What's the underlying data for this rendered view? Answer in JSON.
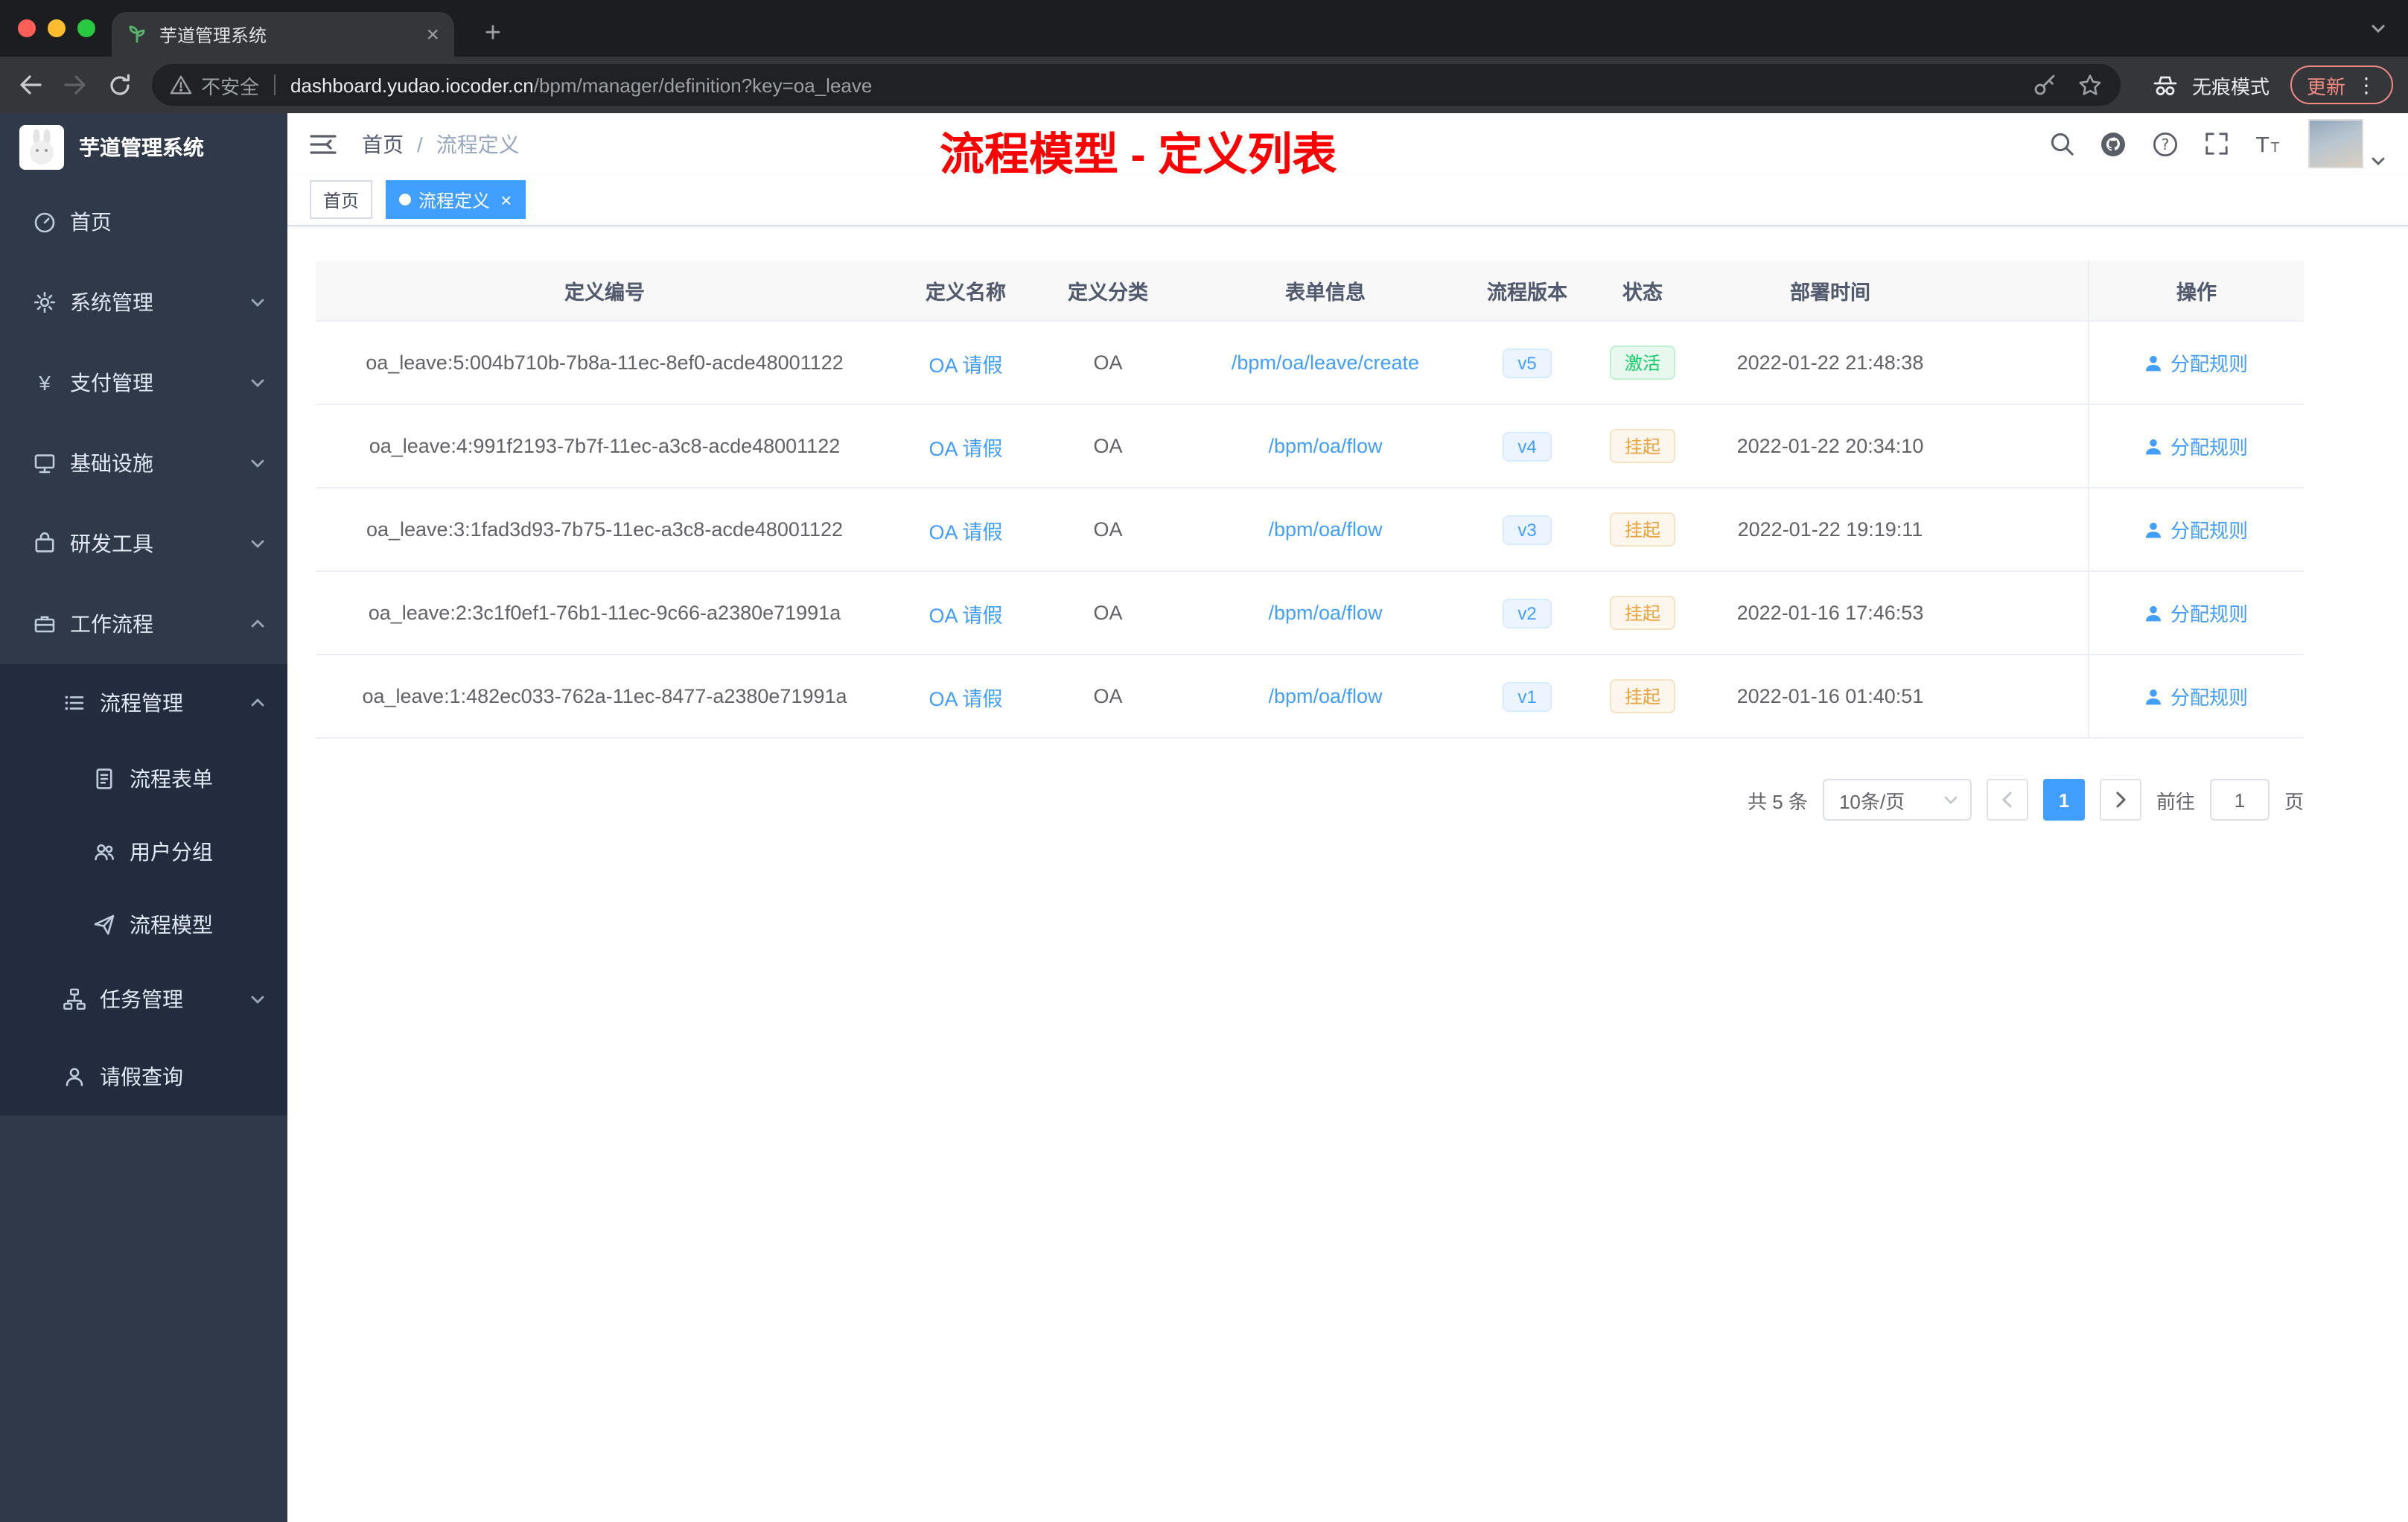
{
  "browser": {
    "tab_title": "芋道管理系统",
    "security_label": "不安全",
    "url_host": "dashboard.yudao.iocoder.cn",
    "url_path": "/bpm/manager/definition?key=oa_leave",
    "incognito_label": "无痕模式",
    "update_label": "更新"
  },
  "sidebar": {
    "logo_title": "芋道管理系统",
    "items": [
      {
        "label": "首页",
        "icon": "dashboard-icon"
      },
      {
        "label": "系统管理",
        "icon": "gear-icon"
      },
      {
        "label": "支付管理",
        "icon": "yen-icon"
      },
      {
        "label": "基础设施",
        "icon": "monitor-icon"
      },
      {
        "label": "研发工具",
        "icon": "toolbox-icon"
      },
      {
        "label": "工作流程",
        "icon": "briefcase-icon",
        "expanded": true,
        "children": [
          {
            "label": "流程管理",
            "icon": "list-icon",
            "expanded": true,
            "children": [
              {
                "label": "流程表单",
                "icon": "document-icon"
              },
              {
                "label": "用户分组",
                "icon": "users-icon"
              },
              {
                "label": "流程模型",
                "icon": "paper-plane-icon"
              }
            ]
          },
          {
            "label": "任务管理",
            "icon": "tree-icon"
          },
          {
            "label": "请假查询",
            "icon": "user-icon"
          }
        ]
      }
    ]
  },
  "header": {
    "breadcrumb": [
      "首页",
      "流程定义"
    ],
    "breadcrumb_separator": "/",
    "annotation": "流程模型 - 定义列表"
  },
  "tags": {
    "items": [
      {
        "label": "首页",
        "active": false
      },
      {
        "label": "流程定义",
        "active": true
      }
    ]
  },
  "table": {
    "columns": [
      "定义编号",
      "定义名称",
      "定义分类",
      "表单信息",
      "流程版本",
      "状态",
      "部署时间",
      "操作"
    ],
    "rows": [
      {
        "id": "oa_leave:5:004b710b-7b8a-11ec-8ef0-acde48001122",
        "name": "OA 请假",
        "category": "OA",
        "form": "/bpm/oa/leave/create",
        "version": "v5",
        "status": "激活",
        "status_type": "success",
        "deployed": "2022-01-22 21:48:38",
        "action": "分配规则"
      },
      {
        "id": "oa_leave:4:991f2193-7b7f-11ec-a3c8-acde48001122",
        "name": "OA 请假",
        "category": "OA",
        "form": "/bpm/oa/flow",
        "version": "v4",
        "status": "挂起",
        "status_type": "warning",
        "deployed": "2022-01-22 20:34:10",
        "action": "分配规则"
      },
      {
        "id": "oa_leave:3:1fad3d93-7b75-11ec-a3c8-acde48001122",
        "name": "OA 请假",
        "category": "OA",
        "form": "/bpm/oa/flow",
        "version": "v3",
        "status": "挂起",
        "status_type": "warning",
        "deployed": "2022-01-22 19:19:11",
        "action": "分配规则"
      },
      {
        "id": "oa_leave:2:3c1f0ef1-76b1-11ec-9c66-a2380e71991a",
        "name": "OA 请假",
        "category": "OA",
        "form": "/bpm/oa/flow",
        "version": "v2",
        "status": "挂起",
        "status_type": "warning",
        "deployed": "2022-01-16 17:46:53",
        "action": "分配规则"
      },
      {
        "id": "oa_leave:1:482ec033-762a-11ec-8477-a2380e71991a",
        "name": "OA 请假",
        "category": "OA",
        "form": "/bpm/oa/flow",
        "version": "v1",
        "status": "挂起",
        "status_type": "warning",
        "deployed": "2022-01-16 01:40:51",
        "action": "分配规则"
      }
    ]
  },
  "pagination": {
    "total": "共 5 条",
    "page_size": "10条/页",
    "page": "1",
    "goto_label": "前往",
    "goto_value": "1",
    "goto_unit": "页"
  },
  "colors": {
    "accent": "#409eff",
    "annotation_red": "#fd0100",
    "status_success": "#13ce66",
    "status_warning": "#e6a23c",
    "sidebar_bg": "#2f3949",
    "sidebar_submenu_bg": "#232c3e"
  }
}
